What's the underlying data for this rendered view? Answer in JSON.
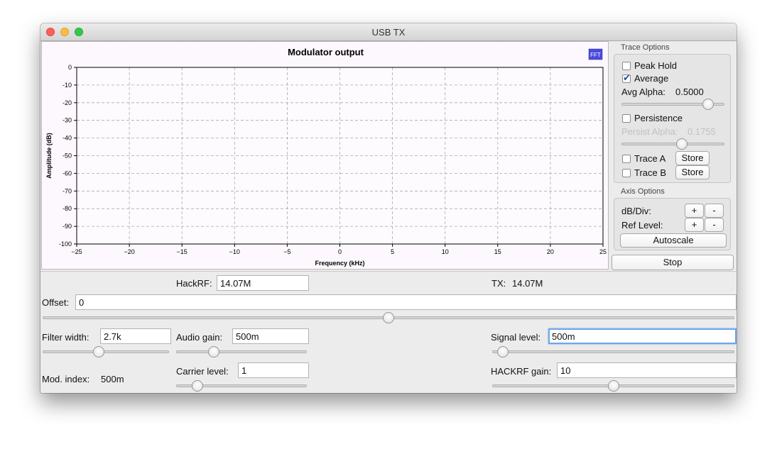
{
  "window": {
    "title": "USB TX"
  },
  "chart_data": {
    "type": "line",
    "title": "Modulator output",
    "xlabel": "Frequency (kHz)",
    "ylabel": "Amplitude (dB)",
    "xlim": [
      -25,
      25
    ],
    "ylim": [
      -100,
      0
    ],
    "xticks": [
      -25,
      -20,
      -15,
      -10,
      -5,
      0,
      5,
      10,
      15,
      20,
      25
    ],
    "yticks": [
      0,
      -10,
      -20,
      -30,
      -40,
      -50,
      -60,
      -70,
      -80,
      -90,
      -100
    ],
    "grid": true,
    "series": [],
    "badge": "FFT"
  },
  "trace_options": {
    "title": "Trace Options",
    "peak_hold": {
      "label": "Peak Hold",
      "checked": false
    },
    "average": {
      "label": "Average",
      "checked": true
    },
    "avg_alpha": {
      "label": "Avg Alpha:",
      "value": "0.5000",
      "slider": 0.88
    },
    "persistence": {
      "label": "Persistence",
      "checked": false
    },
    "persist_alpha": {
      "label": "Persist Alpha:",
      "value": "0.1755",
      "slider": 0.6
    },
    "trace_a": {
      "label": "Trace A",
      "checked": false,
      "button": "Store"
    },
    "trace_b": {
      "label": "Trace B",
      "checked": false,
      "button": "Store"
    }
  },
  "axis_options": {
    "title": "Axis Options",
    "db_div": {
      "label": "dB/Div:",
      "plus": "+",
      "minus": "-"
    },
    "ref_level": {
      "label": "Ref Level:",
      "plus": "+",
      "minus": "-"
    },
    "autoscale": "Autoscale"
  },
  "stop_button": "Stop",
  "controls": {
    "hackrf": {
      "label": "HackRF:",
      "value": "14.07M"
    },
    "tx": {
      "label": "TX:",
      "value": "14.07M"
    },
    "offset": {
      "label": "Offset:",
      "value": "0",
      "slider": 0.5
    },
    "filter_width": {
      "label": "Filter width:",
      "value": "2.7k",
      "slider": 0.44
    },
    "audio_gain": {
      "label": "Audio gain:",
      "value": "500m",
      "slider": 0.27
    },
    "signal_level": {
      "label": "Signal level:",
      "value": "500m",
      "slider": 0.02
    },
    "mod_index": {
      "label": "Mod. index:",
      "value": "500m"
    },
    "carrier_level": {
      "label": "Carrier level:",
      "value": "1",
      "slider": 0.13
    },
    "hackrf_gain": {
      "label": "HACKRF gain:",
      "value": "10",
      "slider": 0.5
    }
  }
}
